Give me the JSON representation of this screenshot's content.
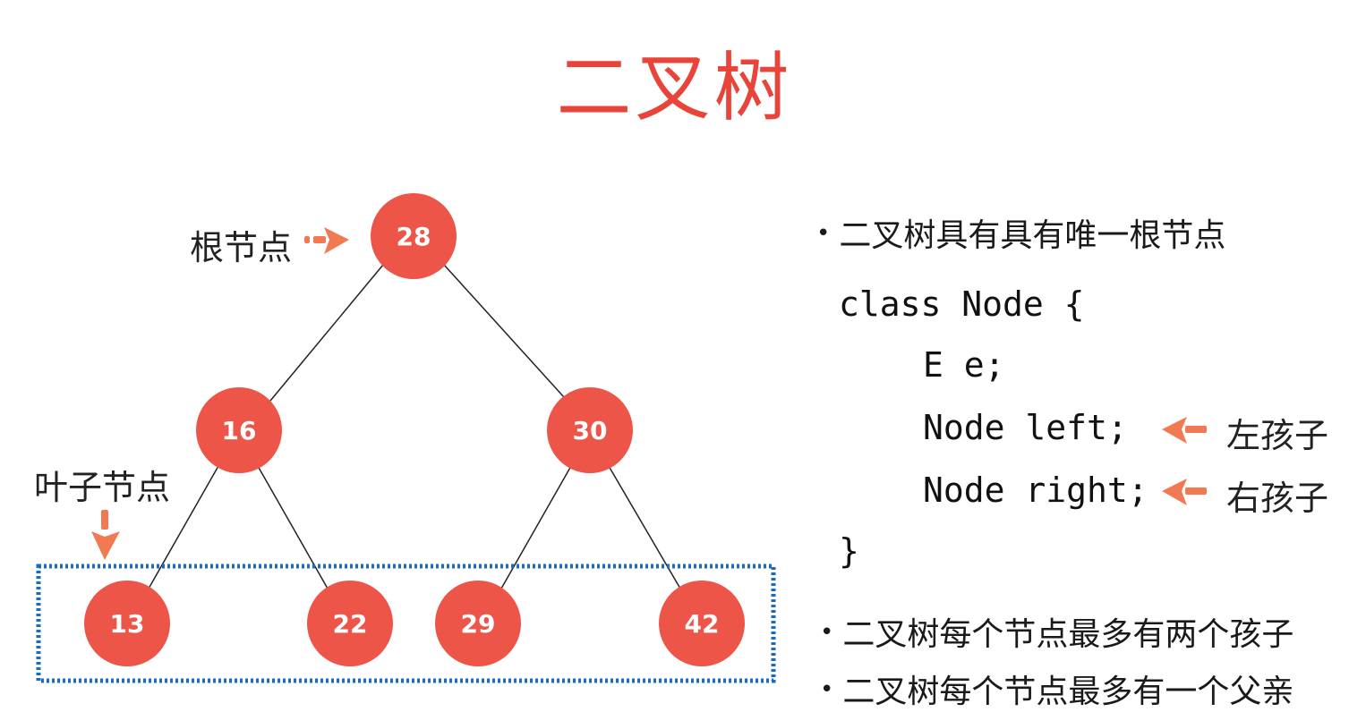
{
  "title": "二叉树",
  "tree": {
    "root_label": "根节点",
    "leaf_label": "叶子节点",
    "nodes": [
      {
        "id": "n28",
        "value": "28"
      },
      {
        "id": "n16",
        "value": "16"
      },
      {
        "id": "n30",
        "value": "30"
      },
      {
        "id": "n13",
        "value": "13"
      },
      {
        "id": "n22",
        "value": "22"
      },
      {
        "id": "n29",
        "value": "29"
      },
      {
        "id": "n42",
        "value": "42"
      }
    ]
  },
  "notes": {
    "bullet1": "二叉树具有具有唯一根节点",
    "bullet2": "二叉树每个节点最多有两个孩子",
    "bullet3": "二叉树每个节点最多有一个父亲"
  },
  "code": {
    "line1": "class Node {",
    "line2": "E e;",
    "line3": "Node left;",
    "line4": "Node right;",
    "line5": "}",
    "left_label": "左孩子",
    "right_label": "右孩子"
  },
  "colors": {
    "node": "#ee5549",
    "title": "#e8443a",
    "arrow": "#f27a52",
    "leaf_box": "#1a6cc0"
  }
}
